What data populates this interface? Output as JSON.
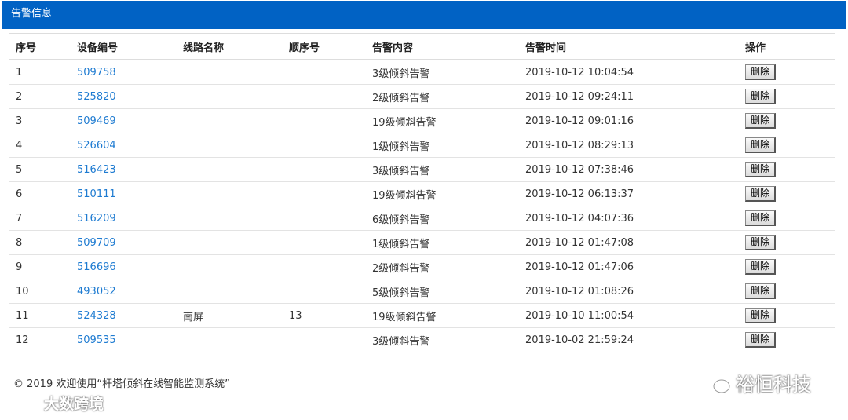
{
  "header": {
    "title": "告警信息"
  },
  "table": {
    "columns": [
      "序号",
      "设备编号",
      "线路名称",
      "顺序号",
      "告警内容",
      "告警时间",
      "操作"
    ],
    "rows": [
      {
        "index": "1",
        "device": "509758",
        "line": "",
        "seq": "",
        "content": "3级倾斜告警",
        "time": "2019-10-12 10:04:54",
        "action": "删除"
      },
      {
        "index": "2",
        "device": "525820",
        "line": "",
        "seq": "",
        "content": "2级倾斜告警",
        "time": "2019-10-12 09:24:11",
        "action": "删除"
      },
      {
        "index": "3",
        "device": "509469",
        "line": "",
        "seq": "",
        "content": "19级倾斜告警",
        "time": "2019-10-12 09:01:16",
        "action": "删除"
      },
      {
        "index": "4",
        "device": "526604",
        "line": "",
        "seq": "",
        "content": "1级倾斜告警",
        "time": "2019-10-12 08:29:13",
        "action": "删除"
      },
      {
        "index": "5",
        "device": "516423",
        "line": "",
        "seq": "",
        "content": "3级倾斜告警",
        "time": "2019-10-12 07:38:46",
        "action": "删除"
      },
      {
        "index": "6",
        "device": "510111",
        "line": "",
        "seq": "",
        "content": "19级倾斜告警",
        "time": "2019-10-12 06:13:37",
        "action": "删除"
      },
      {
        "index": "7",
        "device": "516209",
        "line": "",
        "seq": "",
        "content": "6级倾斜告警",
        "time": "2019-10-12 04:07:36",
        "action": "删除"
      },
      {
        "index": "8",
        "device": "509709",
        "line": "",
        "seq": "",
        "content": "1级倾斜告警",
        "time": "2019-10-12 01:47:08",
        "action": "删除"
      },
      {
        "index": "9",
        "device": "516696",
        "line": "",
        "seq": "",
        "content": "2级倾斜告警",
        "time": "2019-10-12 01:47:06",
        "action": "删除"
      },
      {
        "index": "10",
        "device": "493052",
        "line": "",
        "seq": "",
        "content": "5级倾斜告警",
        "time": "2019-10-12 01:08:26",
        "action": "删除"
      },
      {
        "index": "11",
        "device": "524328",
        "line": "南屏",
        "seq": "13",
        "content": "19级倾斜告警",
        "time": "2019-10-10 11:00:54",
        "action": "删除"
      },
      {
        "index": "12",
        "device": "509535",
        "line": "",
        "seq": "",
        "content": "3级倾斜告警",
        "time": "2019-10-02 21:59:24",
        "action": "删除"
      }
    ]
  },
  "footer": {
    "text": "© 2019 欢迎使用“杆塔倾斜在线智能监测系统”"
  },
  "watermarks": {
    "left": "大数跨境",
    "right": "裕恒科技",
    "left_icon": "logo-icon",
    "right_icon": "wechat-icon"
  },
  "colors": {
    "header_bg": "#0162c4",
    "link": "#1e7bd1"
  }
}
